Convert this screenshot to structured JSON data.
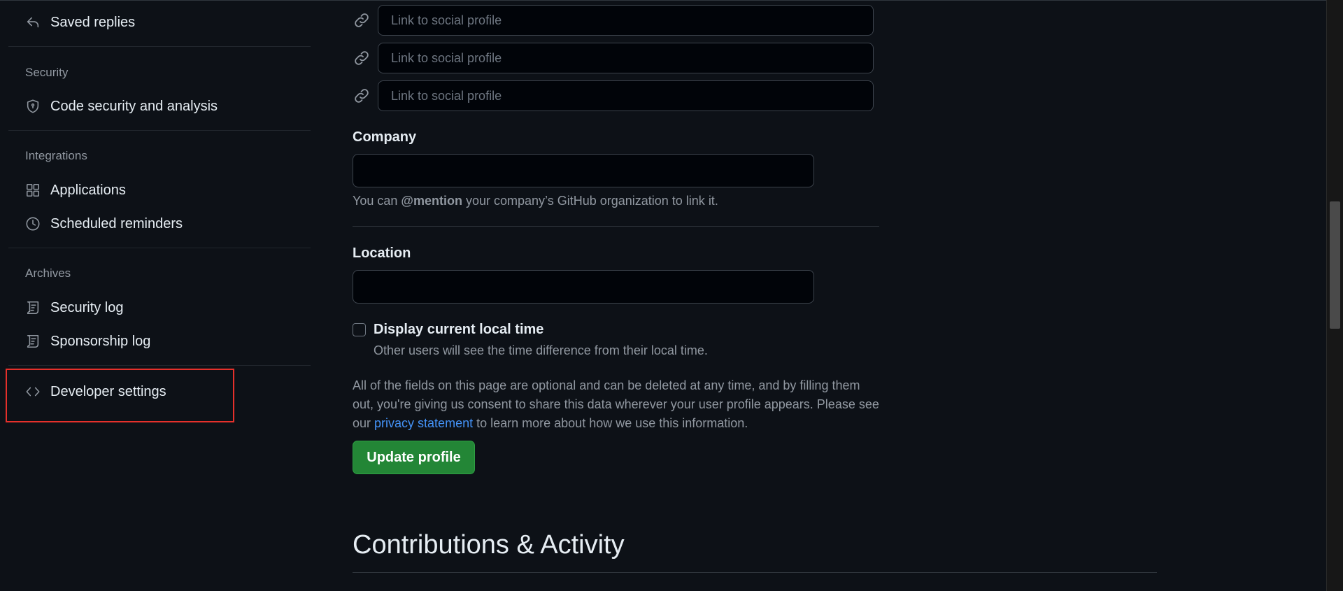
{
  "sidebar": {
    "saved_replies": {
      "label": "Saved replies",
      "icon": "reply-icon"
    },
    "sections": {
      "security": {
        "title": "Security",
        "items": [
          {
            "label": "Code security and analysis",
            "icon": "shield-icon"
          }
        ]
      },
      "integrations": {
        "title": "Integrations",
        "items": [
          {
            "label": "Applications",
            "icon": "apps-icon"
          },
          {
            "label": "Scheduled reminders",
            "icon": "clock-icon"
          }
        ]
      },
      "archives": {
        "title": "Archives",
        "items": [
          {
            "label": "Security log",
            "icon": "log-icon"
          },
          {
            "label": "Sponsorship log",
            "icon": "log-icon"
          }
        ]
      }
    },
    "developer_settings": {
      "label": "Developer settings",
      "icon": "code-icon"
    },
    "highlight_color": "#e5302b"
  },
  "profile_form": {
    "social_links": [
      {
        "placeholder": "Link to social profile",
        "value": ""
      },
      {
        "placeholder": "Link to social profile",
        "value": ""
      },
      {
        "placeholder": "Link to social profile",
        "value": ""
      }
    ],
    "company": {
      "label": "Company",
      "value": "",
      "hint_prefix": "You can ",
      "hint_mention": "@mention",
      "hint_suffix": " your company’s GitHub organization to link it."
    },
    "location": {
      "label": "Location",
      "value": ""
    },
    "local_time": {
      "label": "Display current local time",
      "note": "Other users will see the time difference from their local time.",
      "checked": false
    },
    "disclaimer": {
      "before_link": "All of the fields on this page are optional and can be deleted at any time, and by filling them out, you're giving us consent to share this data wherever your user profile appears. Please see our ",
      "link_text": "privacy statement",
      "after_link": " to learn more about how we use this information."
    },
    "update_button": "Update profile"
  },
  "contributions": {
    "title": "Contributions & Activity"
  },
  "colors": {
    "background": "#0d1117",
    "accent_green": "#238636",
    "link_blue": "#4493f8",
    "muted_text": "#9198a1"
  }
}
